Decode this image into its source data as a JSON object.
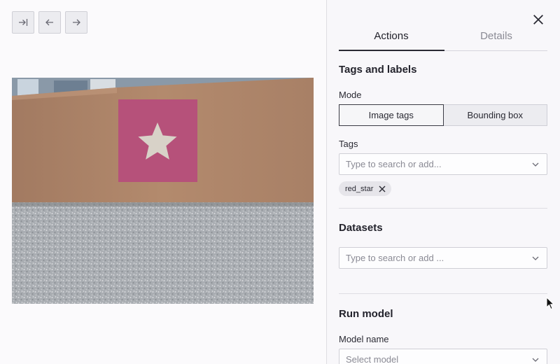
{
  "nav": {
    "first_icon": "skip-to-end-icon",
    "prev_icon": "arrow-left-icon",
    "next_icon": "arrow-right-icon"
  },
  "image": {
    "subject": "red_star"
  },
  "panel": {
    "close_icon": "close-icon",
    "tabs": [
      {
        "label": "Actions",
        "active": true
      },
      {
        "label": "Details",
        "active": false
      }
    ],
    "tags_section": {
      "title": "Tags and labels",
      "mode_label": "Mode",
      "mode_options": [
        "Image tags",
        "Bounding box"
      ],
      "mode_selected": "Image tags",
      "tags_label": "Tags",
      "tags_placeholder": "Type to search or add...",
      "tag_chips": [
        "red_star"
      ]
    },
    "datasets_section": {
      "title": "Datasets",
      "placeholder": "Type to search or add ..."
    },
    "model_section": {
      "title": "Run model",
      "model_label": "Model name",
      "model_placeholder": "Select model"
    }
  },
  "colors": {
    "panel_bg": "#f8f7fa",
    "star_square": "#b6517a",
    "star": "#d8d2c8"
  }
}
